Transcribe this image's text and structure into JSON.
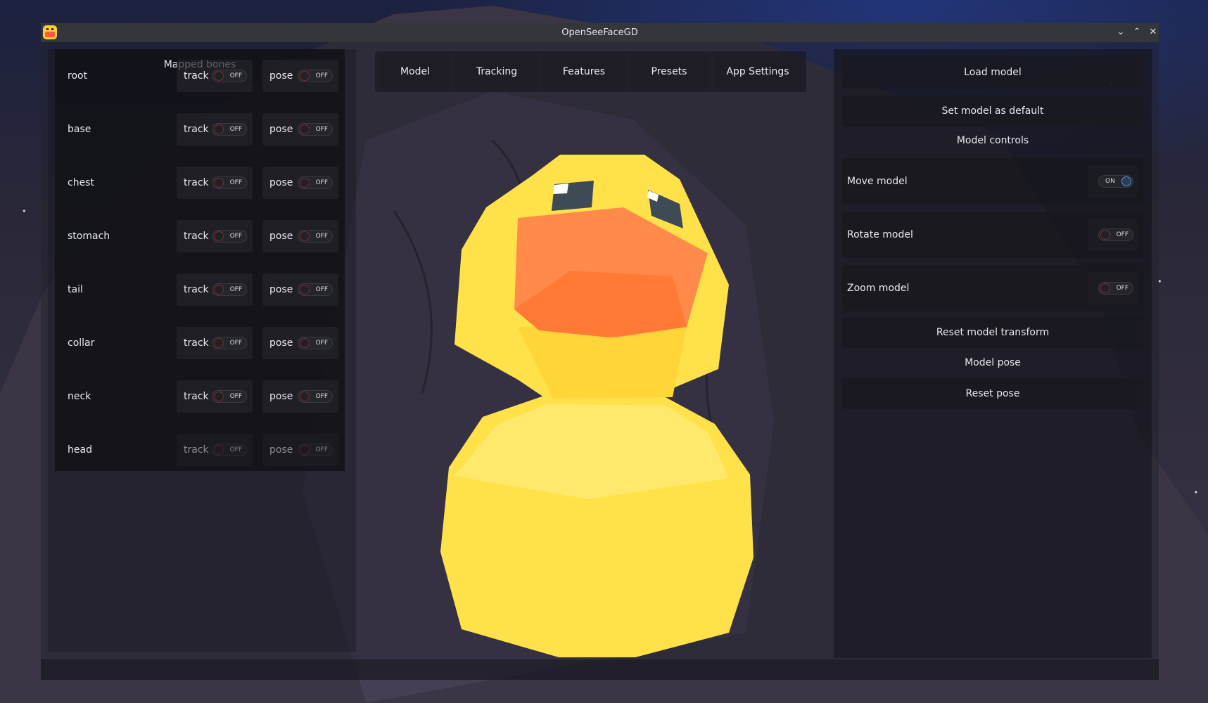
{
  "window": {
    "title": "OpenSeeFaceGD",
    "controls": {
      "minimize": "⌄",
      "maximize": "⌃",
      "close": "✕"
    }
  },
  "bones_panel": {
    "title": "Mapped bones",
    "track_label": "track",
    "pose_label": "pose",
    "off_text": "OFF",
    "bones": [
      {
        "name": "root",
        "track": "OFF",
        "pose": "OFF",
        "enabled": true
      },
      {
        "name": "base",
        "track": "OFF",
        "pose": "OFF",
        "enabled": true
      },
      {
        "name": "chest",
        "track": "OFF",
        "pose": "OFF",
        "enabled": true
      },
      {
        "name": "stomach",
        "track": "OFF",
        "pose": "OFF",
        "enabled": true
      },
      {
        "name": "tail",
        "track": "OFF",
        "pose": "OFF",
        "enabled": true
      },
      {
        "name": "collar",
        "track": "OFF",
        "pose": "OFF",
        "enabled": true
      },
      {
        "name": "neck",
        "track": "OFF",
        "pose": "OFF",
        "enabled": true
      },
      {
        "name": "head",
        "track": "OFF",
        "pose": "OFF",
        "enabled": false
      }
    ]
  },
  "tabs": [
    "Model",
    "Tracking",
    "Features",
    "Presets",
    "App Settings"
  ],
  "model_panel": {
    "load_model": "Load model",
    "set_default": "Set model as default",
    "controls_header": "Model controls",
    "move_model": {
      "label": "Move model",
      "state": "ON"
    },
    "rotate_model": {
      "label": "Rotate model",
      "state": "OFF"
    },
    "zoom_model": {
      "label": "Zoom model",
      "state": "OFF"
    },
    "reset_transform": "Reset model transform",
    "pose_header": "Model pose",
    "reset_pose": "Reset pose"
  },
  "colors": {
    "duck_body": "#ffe24a",
    "duck_beak": "#ff8a4a",
    "duck_eye": "#3e4a56",
    "toggle_on": "#5b8fd6",
    "toggle_off": "#7a2a30"
  }
}
